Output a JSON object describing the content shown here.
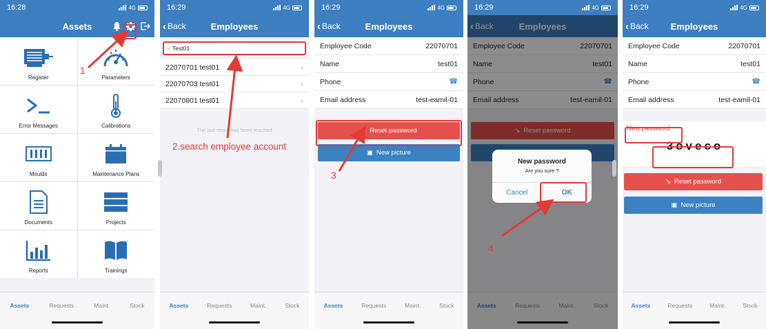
{
  "status_times": [
    "16:28",
    "16:29",
    "16:29",
    "16:29",
    "16:29"
  ],
  "network": "4G",
  "screen1": {
    "title": "Assets",
    "tiles": [
      "Register",
      "Parameters",
      "Error Messages",
      "Calibrations",
      "Moulds",
      "Maintenance Plans",
      "Documents",
      "Projects",
      "Reports",
      "Trainings"
    ]
  },
  "nav": {
    "back": "Back",
    "title": "Employees"
  },
  "tabs": [
    "Assets",
    "Requests",
    "Maint.",
    "Stock"
  ],
  "screen2": {
    "search_value": "Test01",
    "results": [
      "22070701 test01",
      "22070703 test01",
      "22070801 test01"
    ],
    "end_note": "The last result has been reached"
  },
  "employee": {
    "code_label": "Employee Code",
    "code": "22070701",
    "name_label": "Name",
    "name": "test01",
    "phone_label": "Phone",
    "email_label": "Email address",
    "email": "test-eamil-01"
  },
  "buttons": {
    "reset": "Reset password",
    "picture": "New picture"
  },
  "dialog": {
    "title": "New password",
    "message": "Are you sure ?",
    "cancel": "Cancel",
    "ok": "OK"
  },
  "new_password": {
    "label": "New password",
    "value": "3oveco"
  },
  "annotations": {
    "a1": "1",
    "a2": "2.search employee account",
    "a3": "3",
    "a4": "4"
  },
  "colors": {
    "primary": "#3d7fc1",
    "danger": "#e5504c",
    "annotation": "#e53935"
  }
}
